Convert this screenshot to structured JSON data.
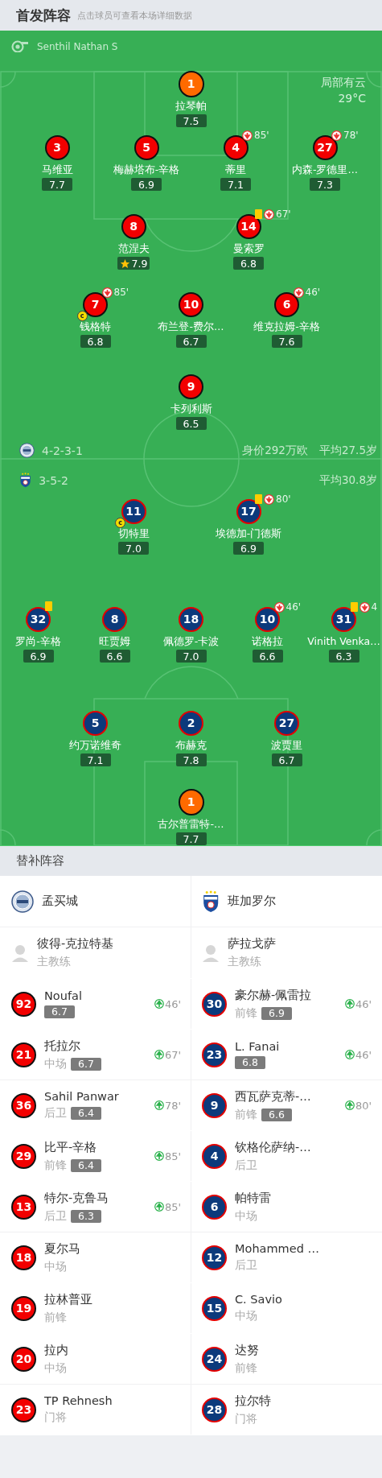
{
  "header": {
    "title": "首发阵容",
    "hint": "点击球员可查看本场详细数据"
  },
  "pitch": {
    "referee": "Senthil Nathan S",
    "weather": "局部有云",
    "temperature": "29°C",
    "home": {
      "formation": "4-2-3-1",
      "value": "身价292万欧",
      "avg_age": "平均27.5岁",
      "lines": [
        [
          {
            "number": "1",
            "name": "拉琴帕",
            "rating": "7.5",
            "kind": "goalkeeper",
            "yellow_card": false,
            "best": false
          }
        ],
        [
          {
            "number": "3",
            "name": "马维亚",
            "rating": "7.7",
            "kind": "outfield",
            "yellow_card": false,
            "best": false
          },
          {
            "number": "5",
            "name": "梅赫塔布-辛格",
            "rating": "6.9",
            "kind": "outfield",
            "yellow_card": false,
            "best": false
          },
          {
            "number": "4",
            "name": "蒂里",
            "rating": "7.1",
            "kind": "outfield",
            "yellow_card": false,
            "best": false,
            "off": "85'"
          },
          {
            "number": "27",
            "name": "内森-罗德里…",
            "rating": "7.3",
            "kind": "outfield",
            "yellow_card": false,
            "best": false,
            "off": "78'"
          }
        ],
        [
          {
            "number": "8",
            "name": "范涅夫",
            "rating": "7.9",
            "kind": "outfield",
            "yellow_card": false,
            "best": true
          },
          {
            "number": "14",
            "name": "曼索罗",
            "rating": "6.8",
            "kind": "outfield",
            "yellow_card": true,
            "best": false,
            "off": "67'"
          }
        ],
        [
          {
            "number": "7",
            "name": "钱格特",
            "rating": "6.8",
            "kind": "outfield",
            "yellow_card": false,
            "best": false,
            "off": "85'",
            "captain": "c"
          },
          {
            "number": "10",
            "name": "布兰登-费尔…",
            "rating": "6.7",
            "kind": "outfield",
            "yellow_card": false,
            "best": false
          },
          {
            "number": "6",
            "name": "维克拉姆-辛格",
            "rating": "7.6",
            "kind": "outfield",
            "yellow_card": false,
            "best": false,
            "off": "46'"
          }
        ],
        [
          {
            "number": "9",
            "name": "卡列利斯",
            "rating": "6.5",
            "kind": "outfield",
            "yellow_card": false,
            "best": false
          }
        ]
      ]
    },
    "away": {
      "formation": "3-5-2",
      "avg_age": "平均30.8岁",
      "lines": [
        [
          {
            "number": "11",
            "name": "切特里",
            "rating": "7.0",
            "kind": "outfield",
            "yellow_card": false,
            "best": false,
            "captain": "c"
          },
          {
            "number": "17",
            "name": "埃德加-门德斯",
            "rating": "6.9",
            "kind": "outfield",
            "yellow_card": true,
            "best": false,
            "off": "80'"
          }
        ],
        [
          {
            "number": "32",
            "name": "罗尚-辛格",
            "rating": "6.9",
            "kind": "outfield",
            "yellow_card": true,
            "best": false
          },
          {
            "number": "8",
            "name": "旺贾姆",
            "rating": "6.6",
            "kind": "outfield",
            "yellow_card": false,
            "best": false
          },
          {
            "number": "18",
            "name": "佩德罗-卡波",
            "rating": "7.0",
            "kind": "outfield",
            "yellow_card": false,
            "best": false
          },
          {
            "number": "10",
            "name": "诺格拉",
            "rating": "6.6",
            "kind": "outfield",
            "yellow_card": false,
            "best": false,
            "off": "46'"
          },
          {
            "number": "31",
            "name": "Vinith Venka…",
            "rating": "6.3",
            "kind": "outfield",
            "yellow_card": true,
            "best": false,
            "off": "4"
          }
        ],
        [
          {
            "number": "5",
            "name": "约万诺维奇",
            "rating": "7.1",
            "kind": "outfield",
            "yellow_card": false,
            "best": false
          },
          {
            "number": "2",
            "name": "布赫克",
            "rating": "7.8",
            "kind": "outfield",
            "yellow_card": false,
            "best": false
          },
          {
            "number": "27",
            "name": "波贾里",
            "rating": "6.7",
            "kind": "outfield",
            "yellow_card": false,
            "best": false
          }
        ],
        [
          {
            "number": "1",
            "name": "古尔普雷特-…",
            "rating": "7.7",
            "kind": "goalkeeper",
            "yellow_card": false,
            "best": false
          }
        ]
      ]
    }
  },
  "subs": {
    "title": "替补阵容",
    "home": {
      "team": "孟买城",
      "coach": "彼得-克拉特基",
      "coach_role": "主教练",
      "players": [
        {
          "number": "92",
          "name": "Noufal",
          "rating": "6.7",
          "in": "46'"
        },
        {
          "number": "21",
          "name": "托拉尔",
          "position": "中场",
          "rating": "6.7",
          "in": "67'"
        },
        {
          "number": "36",
          "name": "Sahil Panwar",
          "position": "后卫",
          "rating": "6.4",
          "in": "78'"
        },
        {
          "number": "29",
          "name": "比平-辛格",
          "position": "前锋",
          "rating": "6.4",
          "in": "85'"
        },
        {
          "number": "13",
          "name": "特尔-克鲁马",
          "position": "后卫",
          "rating": "6.3",
          "in": "85'"
        },
        {
          "number": "18",
          "name": "夏尔马",
          "position": "中场"
        },
        {
          "number": "19",
          "name": "拉林普亚",
          "position": "前锋"
        },
        {
          "number": "20",
          "name": "拉内",
          "position": "中场"
        },
        {
          "number": "23",
          "name": "TP Rehnesh",
          "position": "门将"
        }
      ]
    },
    "away": {
      "team": "班加罗尔",
      "coach": "萨拉戈萨",
      "coach_role": "主教练",
      "players": [
        {
          "number": "30",
          "name": "豪尔赫-佩雷拉",
          "position": "前锋",
          "rating": "6.9",
          "in": "46'"
        },
        {
          "number": "23",
          "name": "L. Fanai",
          "rating": "6.8",
          "in": "46'"
        },
        {
          "number": "9",
          "name": "西瓦萨克蒂-…",
          "position": "前锋",
          "rating": "6.6",
          "in": "80'"
        },
        {
          "number": "4",
          "name": "钦格伦萨纳-…",
          "position": "后卫"
        },
        {
          "number": "6",
          "name": "帕特雷",
          "position": "中场"
        },
        {
          "number": "12",
          "name": "Mohammed …",
          "position": "后卫"
        },
        {
          "number": "15",
          "name": "C. Savio",
          "position": "中场"
        },
        {
          "number": "24",
          "name": "达努",
          "position": "前锋"
        },
        {
          "number": "28",
          "name": "拉尔特",
          "position": "门将"
        }
      ]
    }
  }
}
